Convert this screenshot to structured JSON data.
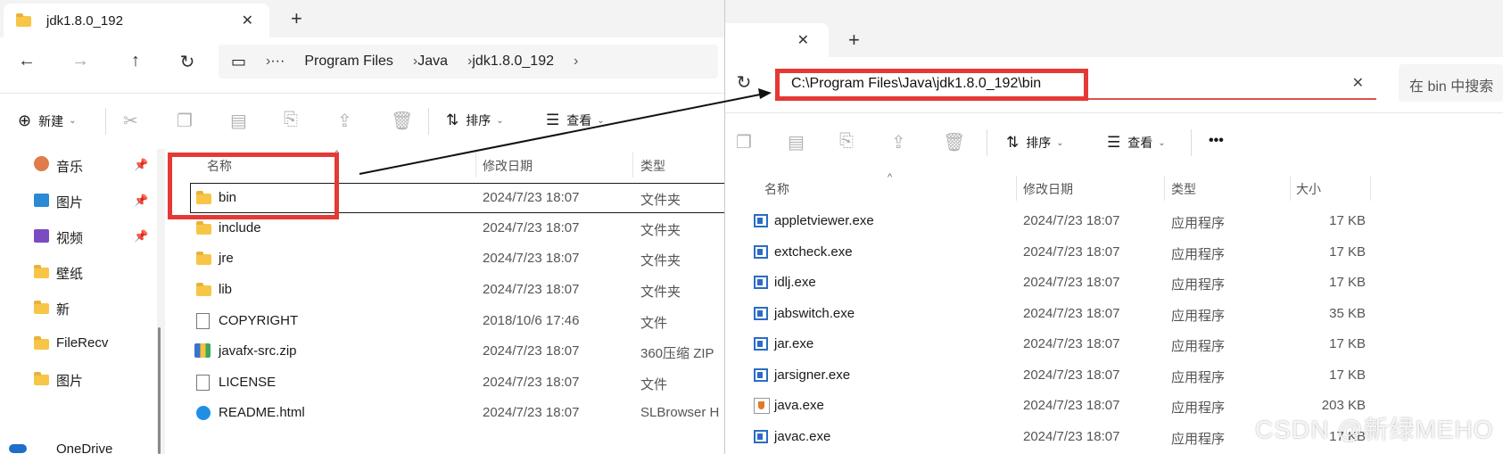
{
  "left": {
    "tab_title": "jdk1.8.0_192",
    "breadcrumb": [
      "Program Files",
      "Java",
      "jdk1.8.0_192"
    ],
    "toolbar": {
      "new_label": "新建",
      "sort_label": "排序",
      "view_label": "查看"
    },
    "sidebar": [
      {
        "label": "音乐",
        "icon": "music-icon",
        "pinned": true
      },
      {
        "label": "图片",
        "icon": "pictures-icon",
        "pinned": true
      },
      {
        "label": "视频",
        "icon": "video-icon",
        "pinned": true
      },
      {
        "label": "壁纸",
        "icon": "folder-icon",
        "pinned": false
      },
      {
        "label": "新",
        "icon": "folder-icon",
        "pinned": false
      },
      {
        "label": "FileRecv",
        "icon": "folder-icon",
        "pinned": false
      },
      {
        "label": "图片",
        "icon": "folder-icon",
        "pinned": false
      },
      {
        "label": "OneDrive",
        "icon": "cloud-icon",
        "pinned": false
      }
    ],
    "columns": {
      "name": "名称",
      "date": "修改日期",
      "type": "类型"
    },
    "files": [
      {
        "name": "bin",
        "date": "2024/7/23 18:07",
        "type": "文件夹",
        "icon": "folder-icon"
      },
      {
        "name": "include",
        "date": "2024/7/23 18:07",
        "type": "文件夹",
        "icon": "folder-icon"
      },
      {
        "name": "jre",
        "date": "2024/7/23 18:07",
        "type": "文件夹",
        "icon": "folder-icon"
      },
      {
        "name": "lib",
        "date": "2024/7/23 18:07",
        "type": "文件夹",
        "icon": "folder-icon"
      },
      {
        "name": "COPYRIGHT",
        "date": "2018/10/6 17:46",
        "type": "文件",
        "icon": "file-icon"
      },
      {
        "name": "javafx-src.zip",
        "date": "2024/7/23 18:07",
        "type": "360压缩 ZIP",
        "icon": "zip-icon"
      },
      {
        "name": "LICENSE",
        "date": "2024/7/23 18:07",
        "type": "文件",
        "icon": "file-icon"
      },
      {
        "name": "README.html",
        "date": "2024/7/23 18:07",
        "type": "SLBrowser H",
        "icon": "html-icon"
      }
    ]
  },
  "right": {
    "address": "C:\\Program Files\\Java\\jdk1.8.0_192\\bin",
    "search_placeholder": "在 bin 中搜索",
    "toolbar": {
      "sort_label": "排序",
      "view_label": "查看",
      "more_label": "•••"
    },
    "columns": {
      "name": "名称",
      "date": "修改日期",
      "type": "类型",
      "size": "大小"
    },
    "files": [
      {
        "name": "appletviewer.exe",
        "date": "2024/7/23 18:07",
        "type": "应用程序",
        "size": "17 KB",
        "icon": "exe-icon"
      },
      {
        "name": "extcheck.exe",
        "date": "2024/7/23 18:07",
        "type": "应用程序",
        "size": "17 KB",
        "icon": "exe-icon"
      },
      {
        "name": "idlj.exe",
        "date": "2024/7/23 18:07",
        "type": "应用程序",
        "size": "17 KB",
        "icon": "exe-icon"
      },
      {
        "name": "jabswitch.exe",
        "date": "2024/7/23 18:07",
        "type": "应用程序",
        "size": "35 KB",
        "icon": "exe-icon"
      },
      {
        "name": "jar.exe",
        "date": "2024/7/23 18:07",
        "type": "应用程序",
        "size": "17 KB",
        "icon": "exe-icon"
      },
      {
        "name": "jarsigner.exe",
        "date": "2024/7/23 18:07",
        "type": "应用程序",
        "size": "17 KB",
        "icon": "exe-icon"
      },
      {
        "name": "java.exe",
        "date": "2024/7/23 18:07",
        "type": "应用程序",
        "size": "203 KB",
        "icon": "java-icon"
      },
      {
        "name": "javac.exe",
        "date": "2024/7/23 18:07",
        "type": "应用程序",
        "size": "17 KB",
        "icon": "exe-icon"
      }
    ]
  },
  "watermark": "CSDN @新绿MEHO",
  "colors": {
    "highlight": "#e53935",
    "window_bg": "#f3f3f3"
  }
}
